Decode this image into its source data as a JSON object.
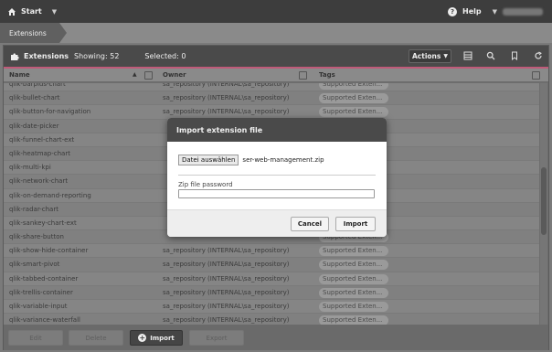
{
  "topbar": {
    "start_label": "Start",
    "help_label": "Help"
  },
  "breadcrumb": {
    "label": "Extensions"
  },
  "panel": {
    "title": "Extensions",
    "showing": "Showing: 52",
    "selected": "Selected: 0",
    "actions_label": "Actions",
    "accent_color": "#c05a79"
  },
  "table": {
    "columns": [
      "Name",
      "Owner",
      "Tags"
    ],
    "rows": [
      {
        "name": "qlik-barplus-chart",
        "owner": "sa_repository (INTERNAL\\sa_repository)",
        "tag": "Supported Exten..."
      },
      {
        "name": "qlik-bullet-chart",
        "owner": "sa_repository (INTERNAL\\sa_repository)",
        "tag": "Supported Exten..."
      },
      {
        "name": "qlik-button-for-navigation",
        "owner": "sa_repository (INTERNAL\\sa_repository)",
        "tag": "Supported Exten..."
      },
      {
        "name": "qlik-date-picker",
        "owner": "",
        "tag": ""
      },
      {
        "name": "qlik-funnel-chart-ext",
        "owner": "",
        "tag": ""
      },
      {
        "name": "qlik-heatmap-chart",
        "owner": "",
        "tag": ""
      },
      {
        "name": "qlik-multi-kpi",
        "owner": "",
        "tag": ""
      },
      {
        "name": "qlik-network-chart",
        "owner": "",
        "tag": ""
      },
      {
        "name": "qlik-on-demand-reporting",
        "owner": "",
        "tag": ""
      },
      {
        "name": "qlik-radar-chart",
        "owner": "",
        "tag": ""
      },
      {
        "name": "qlik-sankey-chart-ext",
        "owner": "",
        "tag": ""
      },
      {
        "name": "qlik-share-button",
        "owner": "",
        "tag": "Supported Exten..."
      },
      {
        "name": "qlik-show-hide-container",
        "owner": "sa_repository (INTERNAL\\sa_repository)",
        "tag": "Supported Exten..."
      },
      {
        "name": "qlik-smart-pivot",
        "owner": "sa_repository (INTERNAL\\sa_repository)",
        "tag": "Supported Exten..."
      },
      {
        "name": "qlik-tabbed-container",
        "owner": "sa_repository (INTERNAL\\sa_repository)",
        "tag": "Supported Exten..."
      },
      {
        "name": "qlik-trellis-container",
        "owner": "sa_repository (INTERNAL\\sa_repository)",
        "tag": "Supported Exten..."
      },
      {
        "name": "qlik-variable-input",
        "owner": "sa_repository (INTERNAL\\sa_repository)",
        "tag": "Supported Exten..."
      },
      {
        "name": "qlik-variance-waterfall",
        "owner": "sa_repository (INTERNAL\\sa_repository)",
        "tag": "Supported Exten..."
      }
    ]
  },
  "footer": {
    "edit_label": "Edit",
    "delete_label": "Delete",
    "import_label": "Import",
    "export_label": "Export"
  },
  "dialog": {
    "title": "Import extension file",
    "file_button_label": "Datei auswählen",
    "file_name": "ser-web-management.zip",
    "password_label": "Zip file password",
    "password_value": "",
    "cancel_label": "Cancel",
    "import_label": "Import"
  },
  "icons": {
    "topbar": [
      "home-icon",
      "caret-down-icon",
      "help-icon"
    ],
    "panel": [
      "puzzle-icon",
      "table-icon",
      "search-icon",
      "bookmark-icon",
      "refresh-icon",
      "filter-icon",
      "sort-asc-icon",
      "plus-circle-icon"
    ]
  }
}
